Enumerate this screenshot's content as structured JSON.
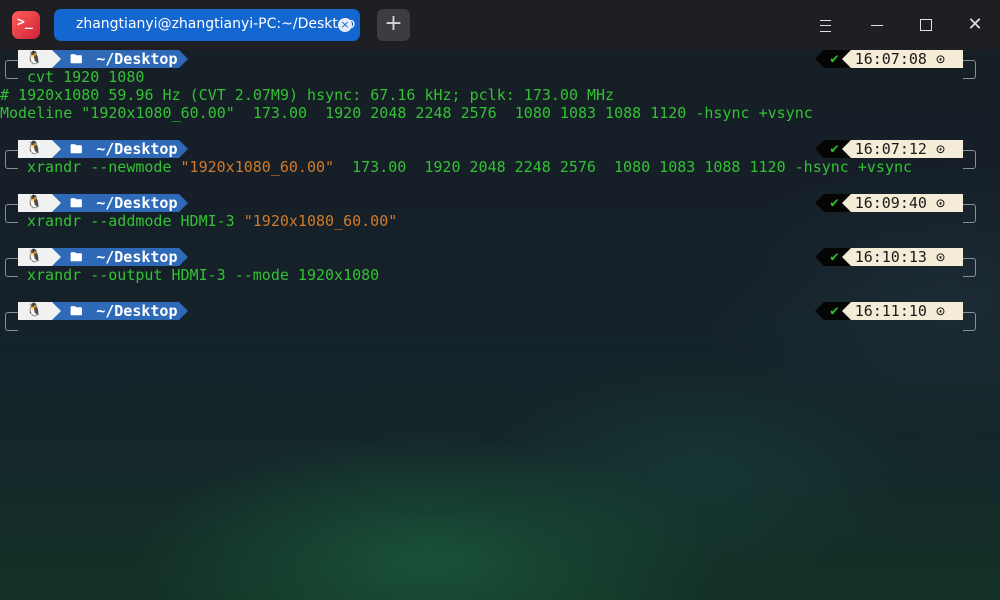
{
  "window": {
    "tab_title": "zhangtianyi@zhangtianyi-PC:~/Desktop",
    "tab_close": "×",
    "add_tab": "+",
    "close_glyph": "✕"
  },
  "prompt": {
    "os_glyph": "🐧",
    "folder_glyph": "🖿",
    "dir": "~/Desktop",
    "status_glyph": "✔",
    "clock_glyph": "⊙"
  },
  "blocks": [
    {
      "time": "16:07:08",
      "command": "cvt 1920 1080",
      "output": [
        "# 1920x1080 59.96 Hz (CVT 2.07M9) hsync: 67.16 kHz; pclk: 173.00 MHz",
        "Modeline \"1920x1080_60.00\"  173.00  1920 2048 2248 2576  1080 1083 1088 1120 -hsync +vsync"
      ]
    },
    {
      "time": "16:07:12",
      "command_pre": "xrandr --newmode ",
      "command_str": "\"1920x1080_60.00\"",
      "command_post": "  173.00  1920 2048 2248 2576  1080 1083 1088 1120 -hsync +vsync"
    },
    {
      "time": "16:09:40",
      "command_pre": "xrandr --addmode HDMI-3 ",
      "command_str": "\"1920x1080_60.00\"",
      "command_post": ""
    },
    {
      "time": "16:10:13",
      "command": "xrandr --output HDMI-3 --mode 1920x1080"
    },
    {
      "time": "16:11:10",
      "command": ""
    }
  ],
  "colors": {
    "tab_active": "#1466d0",
    "dir_segment": "#2f6ab8",
    "command_text": "#33c233",
    "string_text": "#d07a2a"
  }
}
